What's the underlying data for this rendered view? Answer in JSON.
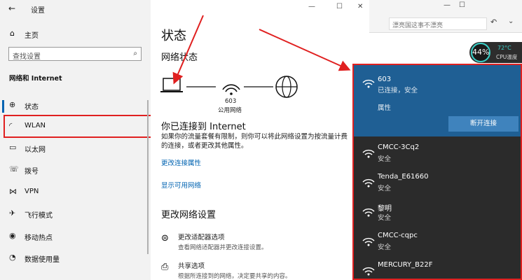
{
  "window": {
    "title": "设置",
    "back_icon": "back-arrow-icon",
    "minimize": "—",
    "maximize": "☐",
    "close": "✕"
  },
  "sidebar": {
    "home": "主页",
    "search_placeholder": "查找设置",
    "section": "网络和 Internet",
    "items": [
      {
        "label": "状态",
        "icon": "globe-icon"
      },
      {
        "label": "WLAN",
        "icon": "wifi-icon"
      },
      {
        "label": "以太网",
        "icon": "ethernet-icon"
      },
      {
        "label": "拨号",
        "icon": "phone-icon"
      },
      {
        "label": "VPN",
        "icon": "vpn-icon"
      },
      {
        "label": "飞行模式",
        "icon": "airplane-icon"
      },
      {
        "label": "移动热点",
        "icon": "hotspot-icon"
      },
      {
        "label": "数据使用量",
        "icon": "data-icon"
      }
    ]
  },
  "main": {
    "title": "状态",
    "network_status": "网络状态",
    "network_name": "603",
    "network_type": "公用网络",
    "connected_heading": "你已连接到 Internet",
    "connected_desc": "如果你的流量套餐有限制，则你可以将此网络设置为按流量计费的连接，或者更改其他属性。",
    "change_props": "更改连接属性",
    "show_networks": "显示可用网络",
    "change_settings": "更改网络设置",
    "adapter_title": "更改适配器选项",
    "adapter_desc": "查看网络适配器并更改连接设置。",
    "sharing_title": "共享选项",
    "sharing_desc": "根据所连接到的网络，决定要共享的内容。"
  },
  "browser": {
    "address_text": "漂亮国这事不漂亮",
    "cpu_percent": "44%",
    "cpu_temp": "72°C",
    "cpu_label": "CPU温度"
  },
  "wifi_panel": {
    "active": {
      "name": "603",
      "status": "已连接，安全",
      "properties": "属性",
      "disconnect": "断开连接"
    },
    "networks": [
      {
        "name": "CMCC-3Cq2",
        "status": "安全"
      },
      {
        "name": "Tenda_E61660",
        "status": "安全"
      },
      {
        "name": "黎明",
        "status": "安全"
      },
      {
        "name": "CMCC-cqpc",
        "status": "安全"
      },
      {
        "name": "MERCURY_B22F",
        "status": "安全"
      }
    ]
  },
  "colors": {
    "accent": "#0063b1",
    "highlight_red": "#e02020",
    "panel_dark": "#2b2b2b",
    "active_blue": "#1f5f94"
  }
}
